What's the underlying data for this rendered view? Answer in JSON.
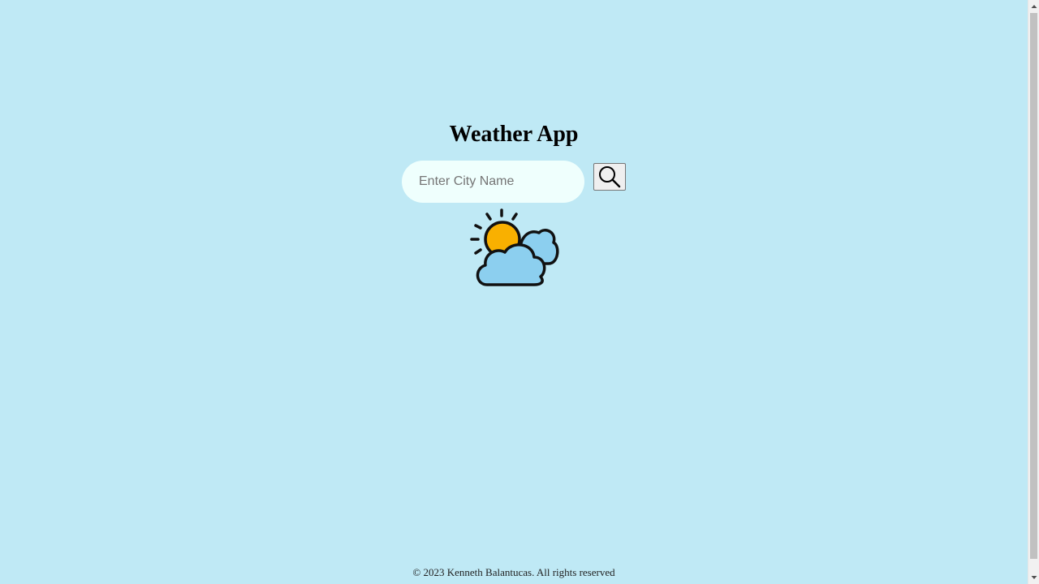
{
  "app": {
    "title": "Weather App"
  },
  "search": {
    "placeholder": "Enter City Name",
    "value": "",
    "button_icon": "search-icon"
  },
  "weather": {
    "icon": "partly-cloudy-icon",
    "colors": {
      "sun": "#f9b000",
      "cloud": "#8ccfef"
    }
  },
  "footer": {
    "text": "© 2023 Kenneth Balantucas. All rights reserved"
  },
  "colors": {
    "background": "#bfe9f5",
    "input_background": "#effffd"
  }
}
